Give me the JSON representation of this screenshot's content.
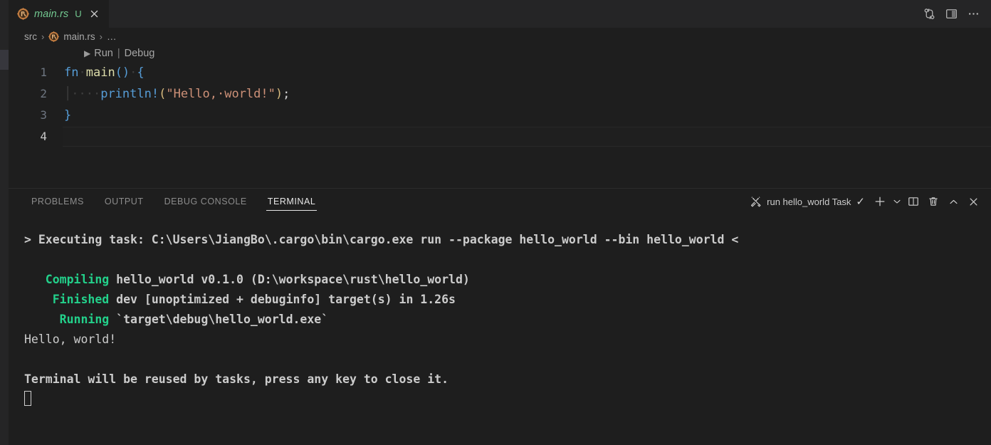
{
  "window": {
    "background": "#1e1e1e",
    "accent_green": "#23d18b",
    "tab_label_color": "#73c991"
  },
  "tabbar": {
    "tabs": [
      {
        "icon": "rust-file-icon",
        "label": "main.rs",
        "badge": "U",
        "close": "×",
        "active": true
      }
    ],
    "actions": [
      {
        "icon": "source-control-compare-icon",
        "name": "compare-changes-button"
      },
      {
        "icon": "split-editor-icon",
        "name": "split-editor-button"
      },
      {
        "icon": "more-actions-icon",
        "name": "more-actions-button"
      }
    ]
  },
  "breadcrumbs": {
    "items": [
      {
        "label": "src",
        "icon": null
      },
      {
        "label": "main.rs",
        "icon": "rust-file-icon"
      },
      {
        "label": "…",
        "icon": null
      }
    ],
    "separator": "›"
  },
  "editor": {
    "codelens": {
      "play_glyph": "▶",
      "run_label": "Run",
      "separator": "|",
      "debug_label": "Debug"
    },
    "active_line": 4,
    "lines": [
      {
        "number": "1",
        "text": "fn main() {",
        "tokens": [
          {
            "t": "fn",
            "c": "t-kw"
          },
          {
            "t": "·",
            "c": "ws-dot"
          },
          {
            "t": "main",
            "c": "t-fn"
          },
          {
            "t": "()",
            "c": "t-punct"
          },
          {
            "t": "·",
            "c": "ws-dot"
          },
          {
            "t": "{",
            "c": "t-punct"
          }
        ]
      },
      {
        "number": "2",
        "text": "    println!(\"Hello, world!\");",
        "tokens": [
          {
            "t": "│",
            "c": "indent-guide"
          },
          {
            "t": "····",
            "c": "ws-dot"
          },
          {
            "t": "println!",
            "c": "t-macro"
          },
          {
            "t": "(",
            "c": "t-paren"
          },
          {
            "t": "\"Hello,·world!\"",
            "c": "t-str"
          },
          {
            "t": ")",
            "c": "t-paren"
          },
          {
            "t": ";",
            "c": "t-plain"
          }
        ]
      },
      {
        "number": "3",
        "text": "}",
        "tokens": [
          {
            "t": "}",
            "c": "t-punct"
          }
        ]
      },
      {
        "number": "4",
        "text": "",
        "tokens": []
      }
    ]
  },
  "panel": {
    "tabs": [
      {
        "label": "PROBLEMS",
        "active": false
      },
      {
        "label": "OUTPUT",
        "active": false
      },
      {
        "label": "DEBUG CONSOLE",
        "active": false
      },
      {
        "label": "TERMINAL",
        "active": true
      }
    ],
    "terminal_selector": {
      "icon": "tools-wrench-icon",
      "label": "run hello_world Task",
      "status_glyph": "✓"
    },
    "actions": [
      {
        "icon": "new-terminal-plus-icon",
        "name": "new-terminal-button"
      },
      {
        "icon": "chevron-down-icon",
        "name": "terminal-profile-dropdown"
      },
      {
        "icon": "split-terminal-icon",
        "name": "split-terminal-button"
      },
      {
        "icon": "trash-icon",
        "name": "kill-terminal-button"
      },
      {
        "icon": "chevron-up-icon",
        "name": "maximize-panel-button"
      },
      {
        "icon": "close-icon",
        "name": "close-panel-button"
      }
    ],
    "terminal_output": [
      {
        "type": "command",
        "bold": true,
        "segments": [
          {
            "text": "> Executing task: C:\\Users\\JiangBo\\.cargo\\bin\\cargo.exe run --package hello_world --bin hello_world <",
            "color": "default"
          }
        ]
      },
      {
        "type": "blank",
        "segments": []
      },
      {
        "type": "output",
        "bold": true,
        "segments": [
          {
            "text": "   Compiling",
            "color": "green"
          },
          {
            "text": " hello_world v0.1.0 (D:\\workspace\\rust\\hello_world)",
            "color": "default"
          }
        ]
      },
      {
        "type": "output",
        "bold": true,
        "segments": [
          {
            "text": "    Finished",
            "color": "green"
          },
          {
            "text": " dev [unoptimized + debuginfo] target(s) in 1.26s",
            "color": "default"
          }
        ]
      },
      {
        "type": "output",
        "bold": true,
        "segments": [
          {
            "text": "     Running",
            "color": "green"
          },
          {
            "text": " `target\\debug\\hello_world.exe`",
            "color": "default"
          }
        ]
      },
      {
        "type": "output",
        "bold": false,
        "segments": [
          {
            "text": "Hello, world!",
            "color": "default"
          }
        ]
      },
      {
        "type": "blank",
        "segments": []
      },
      {
        "type": "output",
        "bold": true,
        "segments": [
          {
            "text": "Terminal will be reused by tasks, press any key to close it.",
            "color": "default"
          }
        ]
      },
      {
        "type": "cursor",
        "segments": []
      }
    ]
  }
}
